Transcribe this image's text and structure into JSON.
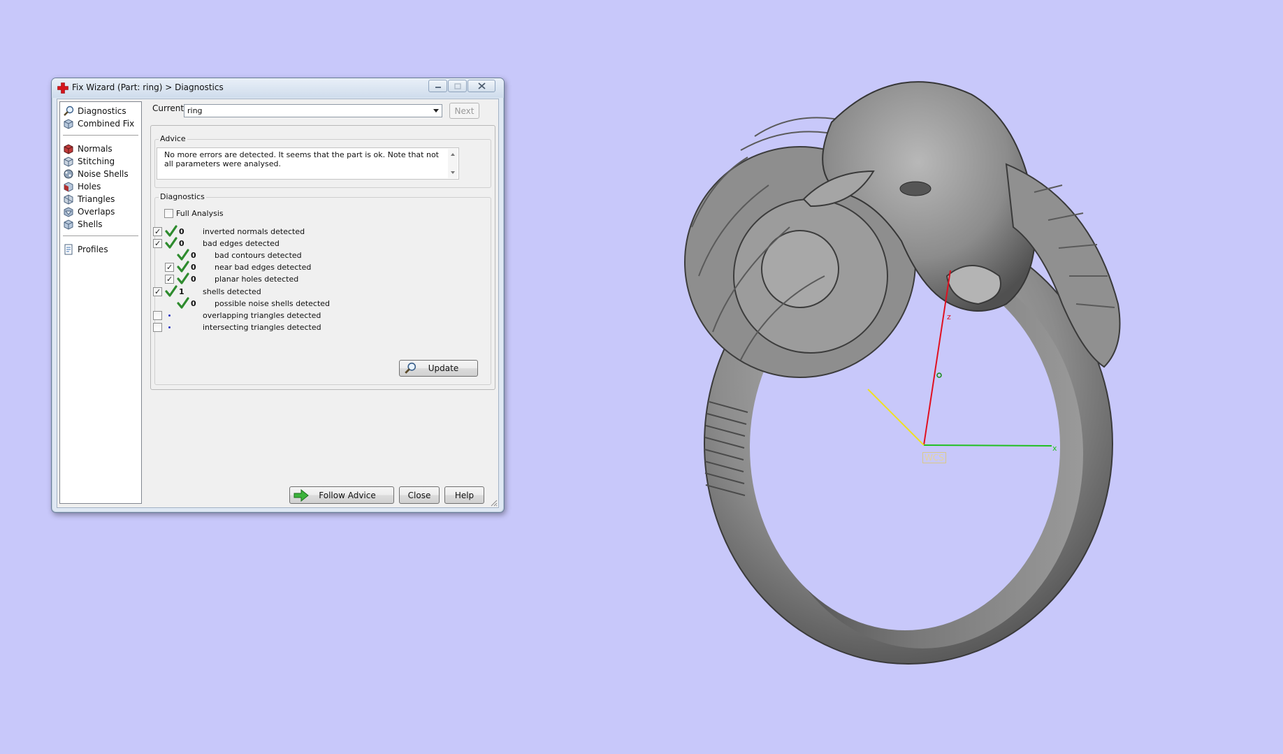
{
  "window": {
    "title": "Fix Wizard (Part: ring) > Diagnostics"
  },
  "sidebar": {
    "items": [
      {
        "label": "Diagnostics",
        "icon": "magnifier-icon"
      },
      {
        "label": "Combined Fix",
        "icon": "combined-fix-icon"
      },
      {
        "label": "Normals",
        "icon": "normals-icon"
      },
      {
        "label": "Stitching",
        "icon": "stitching-icon"
      },
      {
        "label": "Noise Shells",
        "icon": "noise-shells-icon"
      },
      {
        "label": "Holes",
        "icon": "holes-icon"
      },
      {
        "label": "Triangles",
        "icon": "triangles-icon"
      },
      {
        "label": "Overlaps",
        "icon": "overlaps-icon"
      },
      {
        "label": "Shells",
        "icon": "shells-icon"
      },
      {
        "label": "Profiles",
        "icon": "profiles-icon"
      }
    ]
  },
  "current_part": {
    "label": "Current Part:",
    "value": "ring",
    "next_label": "Next"
  },
  "advice": {
    "caption": "Advice",
    "text": "No more errors are detected. It seems that the part is ok. Note that not all parameters were analysed."
  },
  "diagnostics": {
    "caption": "Diagnostics",
    "full_analysis_label": "Full Analysis",
    "full_analysis_checked": false,
    "rows": [
      {
        "checked": true,
        "status": "ok",
        "count": "0",
        "text": "inverted normals detected",
        "indent": 0
      },
      {
        "checked": true,
        "status": "ok",
        "count": "0",
        "text": "bad edges detected",
        "indent": 0
      },
      {
        "checked": null,
        "status": "ok",
        "count": "0",
        "text": "bad contours detected",
        "indent": 1
      },
      {
        "checked": true,
        "status": "ok",
        "count": "0",
        "text": "near bad edges detected",
        "indent": 1
      },
      {
        "checked": true,
        "status": "ok",
        "count": "0",
        "text": "planar holes detected",
        "indent": 1
      },
      {
        "checked": true,
        "status": "ok",
        "count": "1",
        "text": "shells detected",
        "indent": 0
      },
      {
        "checked": null,
        "status": "ok",
        "count": "0",
        "text": "possible noise shells detected",
        "indent": 1
      },
      {
        "checked": false,
        "status": "none",
        "count": "",
        "text": "overlapping triangles detected",
        "indent": 0
      },
      {
        "checked": false,
        "status": "none",
        "count": "",
        "text": "intersecting triangles detected",
        "indent": 0
      }
    ],
    "update_label": "Update"
  },
  "footer": {
    "follow_advice_label": "Follow Advice",
    "close_label": "Close",
    "help_label": "Help"
  },
  "viewport": {
    "background": "#c8c8fa",
    "wcs_label": "WCS",
    "axis_z": "z",
    "axis_x": "x",
    "colors": {
      "z_axis": "#e01020",
      "x_axis": "#20c020",
      "y_axis": "#f0e020"
    }
  }
}
